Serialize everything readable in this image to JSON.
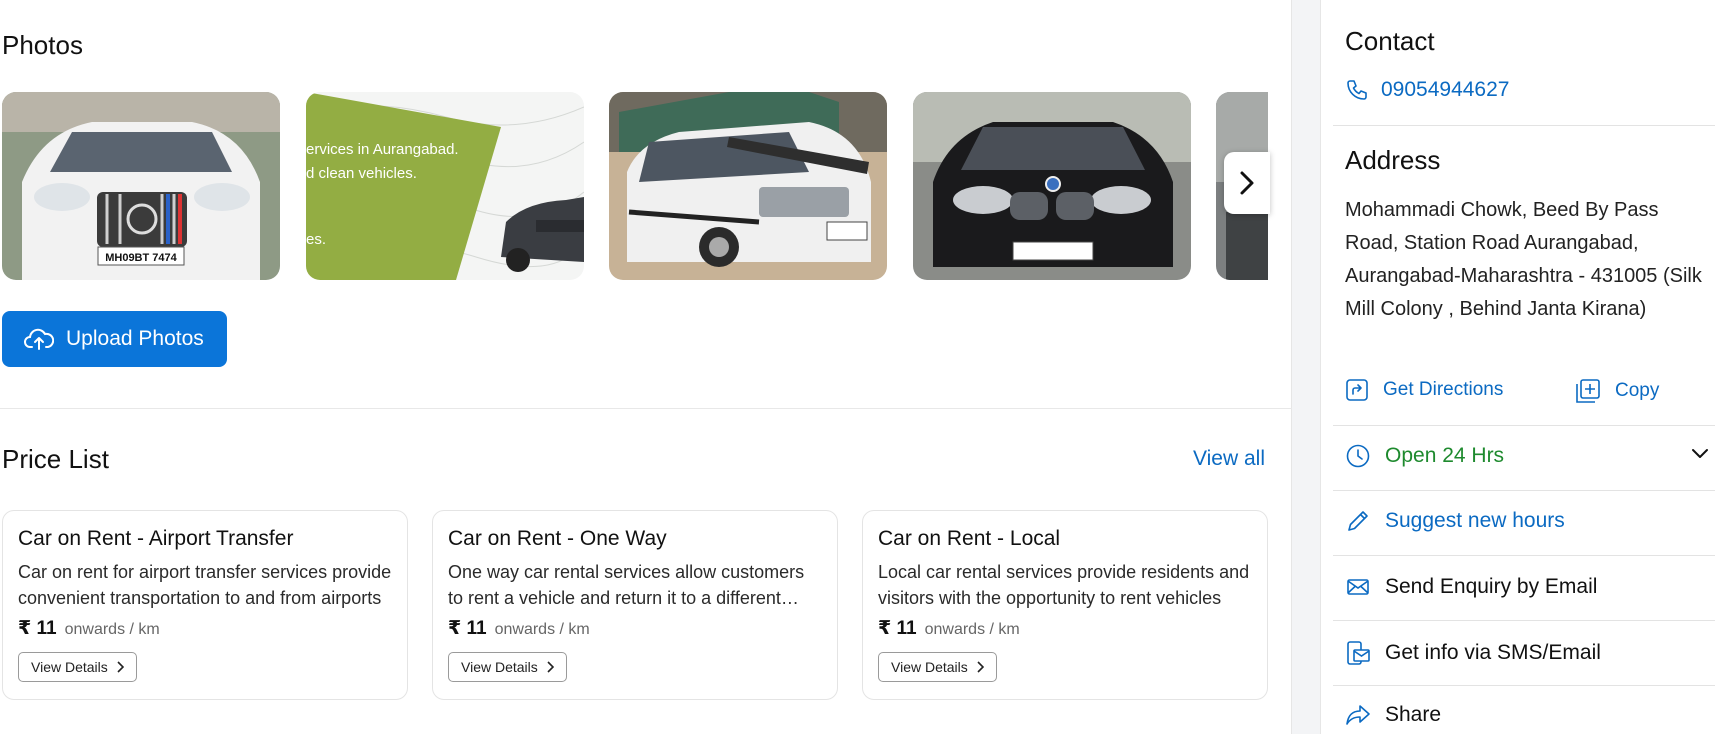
{
  "photos": {
    "title": "Photos",
    "items": [
      {
        "name": "white mercedes",
        "plate": "MH09BT 7474"
      },
      {
        "name": "banner",
        "line1": "ervices in Aurangabad.",
        "line2": "d clean vehicles.",
        "line3": "es."
      },
      {
        "name": "white suv"
      },
      {
        "name": "black bmw"
      },
      {
        "name": "partial photo"
      }
    ],
    "upload_label": "Upload Photos"
  },
  "price_list": {
    "title": "Price List",
    "view_all": "View all",
    "cards": [
      {
        "title": "Car on Rent - Airport Transfer",
        "desc": "Car on rent for airport transfer services provide convenient transportation to and from airports",
        "price": "₹ 11",
        "unit": "onwards / km",
        "button": "View Details"
      },
      {
        "title": "Car on Rent - One Way",
        "desc": "One way car rental services allow customers to rent a vehicle and return it to a different location",
        "price": "₹ 11",
        "unit": "onwards / km",
        "button": "View Details"
      },
      {
        "title": "Car on Rent - Local",
        "desc": "Local car rental services provide residents and visitors with the opportunity to rent vehicles",
        "price": "₹ 11",
        "unit": "onwards / km",
        "button": "View Details"
      }
    ]
  },
  "sidebar": {
    "contact_title": "Contact",
    "phone": "09054944627",
    "address_title": "Address",
    "address": "Mohammadi Chowk, Beed By Pass Road, Station Road Aurangabad, Aurangabad-Maharashtra - 431005 (Silk Mill Colony , Behind Janta Kirana)",
    "get_directions": "Get Directions",
    "copy": "Copy",
    "hours": "Open 24 Hrs",
    "suggest_hours": "Suggest new hours",
    "send_enquiry": "Send Enquiry by Email",
    "get_info": "Get info via SMS/Email",
    "share": "Share"
  },
  "colors": {
    "primary": "#0b75d9",
    "link": "#0b6ac2",
    "open_green": "#1e8a2e"
  }
}
